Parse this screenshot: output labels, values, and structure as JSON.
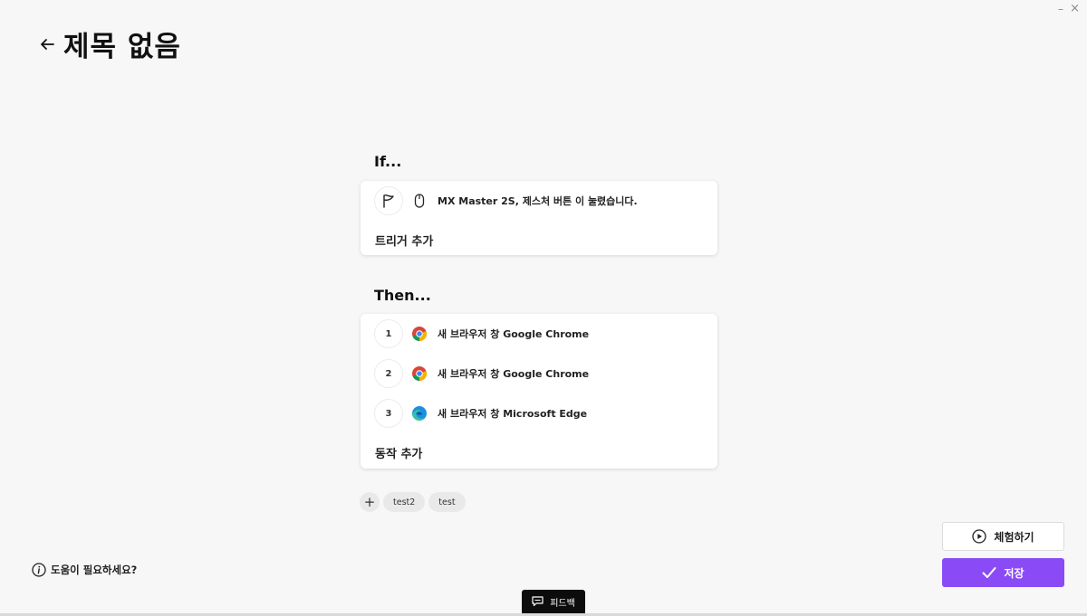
{
  "window": {
    "minimize_glyph": "–",
    "close_glyph": "×"
  },
  "header": {
    "title": "제목 없음",
    "back_icon": "arrow-left-icon"
  },
  "if_section": {
    "heading": "If...",
    "trigger": {
      "icon": "gesture-flag-icon",
      "device_icon": "mouse-icon",
      "text": "MX Master 2S, 제스처 버튼 이 눌렸습니다."
    },
    "add_label": "트리거 추가"
  },
  "then_section": {
    "heading": "Then...",
    "actions": [
      {
        "number": "1",
        "icon": "chrome-icon",
        "text": "새 브라우저 창 Google Chrome"
      },
      {
        "number": "2",
        "icon": "chrome-icon",
        "text": "새 브라우저 창 Google Chrome"
      },
      {
        "number": "3",
        "icon": "edge-icon",
        "text": "새 브라우저 창 Microsoft Edge"
      }
    ],
    "add_label": "동작 추가"
  },
  "tags": {
    "add_glyph": "+",
    "items": [
      "test2",
      "test"
    ]
  },
  "help": {
    "text": "도움이 필요하세요?",
    "icon": "info-icon"
  },
  "buttons": {
    "try_label": "체험하기",
    "save_label": "저장"
  },
  "feedback": {
    "label": "피드백"
  },
  "colors": {
    "accent": "#8a4bf7",
    "background": "#f7f7f7",
    "card": "#ffffff"
  }
}
